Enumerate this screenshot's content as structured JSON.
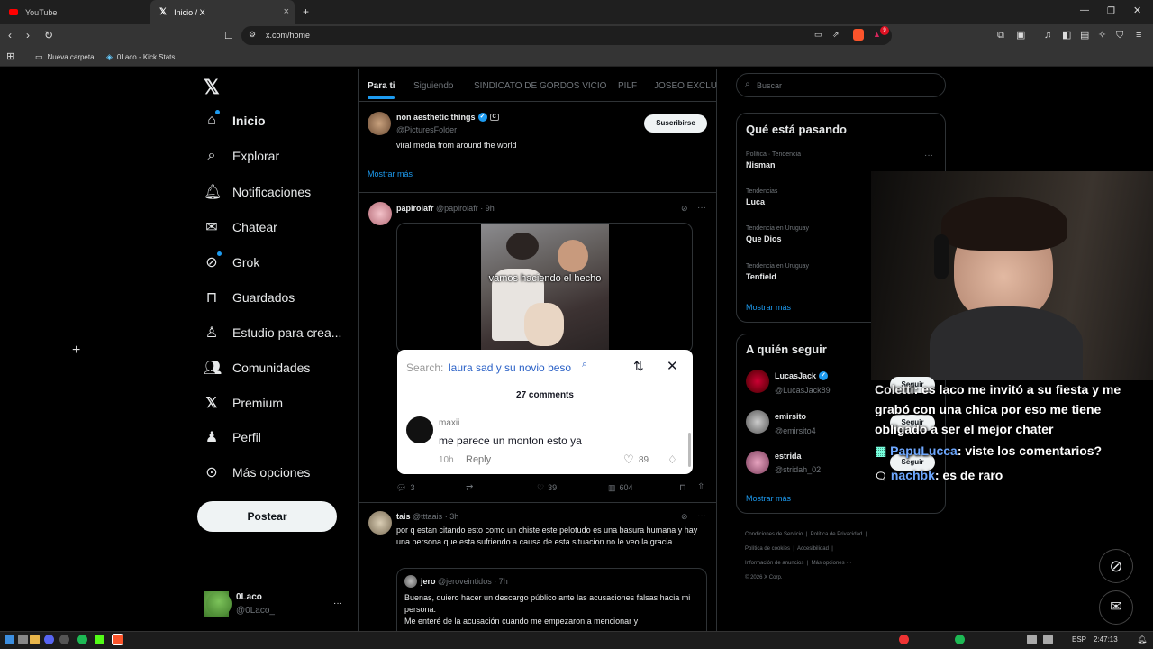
{
  "browser": {
    "tabs": [
      {
        "label": "YouTube"
      },
      {
        "label": "Inicio / X"
      }
    ],
    "url": "x.com/home",
    "bookmarks": [
      {
        "label": "Nueva carpeta"
      },
      {
        "label": "0Laco - Kick Stats"
      }
    ],
    "badge_count": "9"
  },
  "nav": {
    "items": [
      {
        "label": "Inicio"
      },
      {
        "label": "Explorar"
      },
      {
        "label": "Notificaciones"
      },
      {
        "label": "Chatear"
      },
      {
        "label": "Grok"
      },
      {
        "label": "Guardados"
      },
      {
        "label": "Estudio para crea..."
      },
      {
        "label": "Comunidades"
      },
      {
        "label": "Premium"
      },
      {
        "label": "Perfil"
      },
      {
        "label": "Más opciones"
      }
    ],
    "post_label": "Postear",
    "account": {
      "name": "0Laco",
      "handle": "@0Laco_",
      "more": "···"
    }
  },
  "feed": {
    "tabs": [
      "Para ti",
      "Siguiendo",
      "SINDICATO DE GORDOS VICIO",
      "PILF",
      "JOSEO EXCLUSI"
    ],
    "suggestion": {
      "name": "non aesthetic things",
      "badge": "C",
      "handle": "@PicturesFolder",
      "bio": "viral media from around the world",
      "subscribe_label": "Suscribirse",
      "show_more": "Mostrar más"
    },
    "post1": {
      "name": "papirolafr",
      "handle": "@papirolafr",
      "time": "· 9h",
      "media_caption": "vamos haciendo el hecho",
      "stats": {
        "replies": "3",
        "likes": "39",
        "views": "604"
      }
    },
    "post2": {
      "name": "tais",
      "handle": "@tttaais",
      "time": "· 3h",
      "text": "por q estan citando esto como un chiste este pelotudo es una basura humana y hay una persona que esta sufriendo a causa de esta situacion no le veo la gracia",
      "quote": {
        "name": "jero",
        "handle": "@jeroveintidos",
        "time": "· 7h",
        "text": "Buenas, quiero hacer un descargo público ante las acusaciones falsas hacia mi persona.\nMe enteré de la acusación cuando me empezaron a mencionar y"
      }
    }
  },
  "tiktok_overlay": {
    "search_label": "Search:",
    "search_query": "laura sad y su novio beso",
    "comments_count": "27 comments",
    "comment": {
      "user": "maxii",
      "text": "me parece un monton esto ya",
      "time": "10h",
      "reply": "Reply",
      "likes": "89"
    }
  },
  "sidebar": {
    "search_placeholder": "Buscar",
    "trends_title": "Qué está pasando",
    "trends": [
      {
        "meta": "Política · Tendencia",
        "name": "Nisman"
      },
      {
        "meta": "Tendencias",
        "name": "Luca"
      },
      {
        "meta": "Tendencia en Uruguay",
        "name": "Que Dios"
      },
      {
        "meta": "Tendencia en Uruguay",
        "name": "Tenfield"
      }
    ],
    "trends_more": "Mostrar más",
    "follow_title": "A quién seguir",
    "follow": [
      {
        "name": "LucasJack",
        "handle": "@LucasJack89"
      },
      {
        "name": "emirsito",
        "handle": "@emirsito4"
      },
      {
        "name": "estrida",
        "handle": "@stridah_02"
      }
    ],
    "follow_label": "Seguir",
    "follow_more": "Mostrar más",
    "footer": [
      "Condiciones de Servicio",
      "Política de Privacidad",
      "Política de cookies",
      "Accesibilidad",
      "Información de anuncios",
      "Más opciones ···",
      "© 2026 X Corp."
    ]
  },
  "chat_overlay": [
    {
      "user": "Coletti",
      "text": ": es laco me invitó a su fiesta y me grabó con una chica por eso me tiene obligado a ser el mejor chater"
    },
    {
      "user": "PapuLucca",
      "text": ": viste los comentarios?"
    },
    {
      "user": "nachbk",
      "text": ": es de raro"
    }
  ],
  "taskbar": {
    "lang": "ESP",
    "time": "2:47:13"
  },
  "colors": {
    "accent": "#1d9bf0",
    "background": "#000000",
    "border": "#2f3336",
    "muted": "#71767b",
    "brave": "#fb542b"
  }
}
